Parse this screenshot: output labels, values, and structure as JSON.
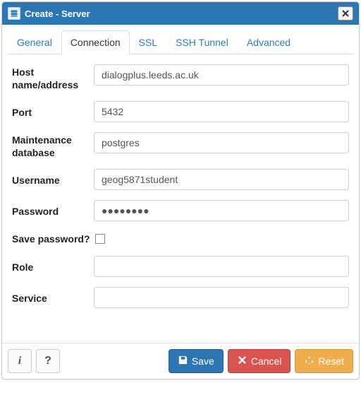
{
  "titlebar": {
    "title": "Create - Server",
    "close_aria": "Close"
  },
  "tabs": [
    {
      "label": "General",
      "active": false
    },
    {
      "label": "Connection",
      "active": true
    },
    {
      "label": "SSL",
      "active": false
    },
    {
      "label": "SSH Tunnel",
      "active": false
    },
    {
      "label": "Advanced",
      "active": false
    }
  ],
  "form": {
    "host": {
      "label": "Host name/address",
      "value": "dialogplus.leeds.ac.uk"
    },
    "port": {
      "label": "Port",
      "value": "5432"
    },
    "maintdb": {
      "label": "Maintenance database",
      "value": "postgres"
    },
    "username": {
      "label": "Username",
      "value": "geog5871student"
    },
    "password": {
      "label": "Password",
      "value": "●●●●●●●●"
    },
    "savepw": {
      "label": "Save password?",
      "checked": false
    },
    "role": {
      "label": "Role",
      "value": ""
    },
    "service": {
      "label": "Service",
      "value": ""
    }
  },
  "footer": {
    "info_label": "i",
    "help_label": "?",
    "save_label": "Save",
    "cancel_label": "Cancel",
    "reset_label": "Reset"
  }
}
